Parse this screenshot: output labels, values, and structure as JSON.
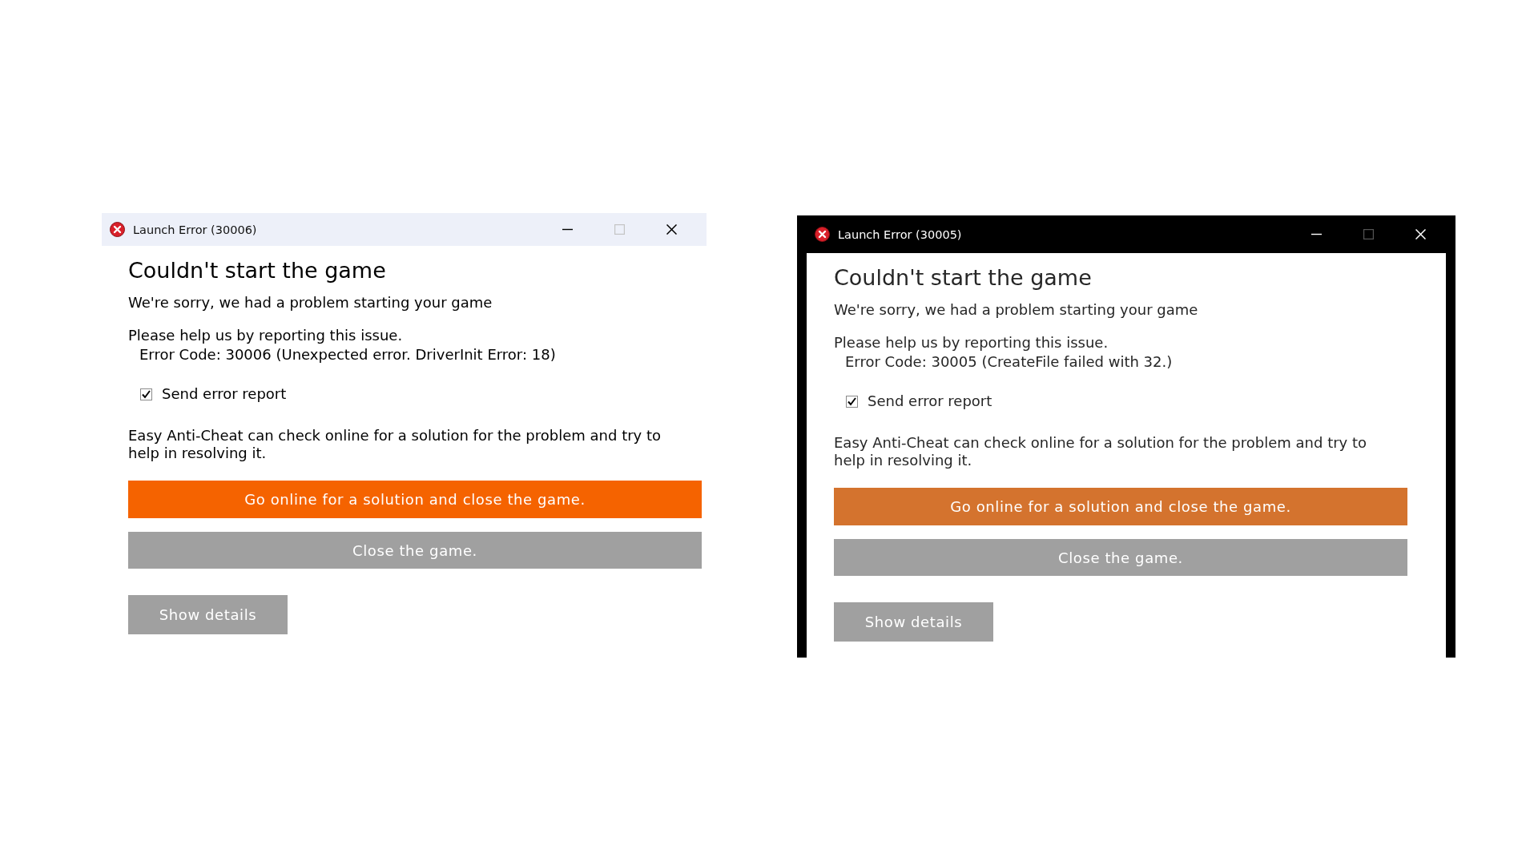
{
  "windows": [
    {
      "kind": "plain",
      "title": "Launch Error (30006)",
      "window_controls": [
        {
          "kind": "minimize",
          "disabled": false
        },
        {
          "kind": "maximize",
          "disabled": true
        },
        {
          "kind": "close",
          "disabled": false
        }
      ],
      "heading": "Couldn't start the game",
      "message": "We're sorry, we had a problem starting your game",
      "report_prompt": "Please help us by reporting this issue.",
      "error_code": "Error Code: 30006 (Unexpected error. DriverInit Error: 18)",
      "send_report": {
        "label": "Send error report",
        "checked": true
      },
      "info": "Easy Anti-Cheat can check online for a solution for the problem and try to help in resolving it.",
      "buttons": [
        {
          "kind": "primary",
          "label": "Go online for a solution and close the game."
        },
        {
          "kind": "secondary",
          "label": "Close the game."
        },
        {
          "kind": "details",
          "label": "Show details"
        }
      ]
    },
    {
      "kind": "framed",
      "title": "Launch Error (30005)",
      "window_controls": [
        {
          "kind": "minimize",
          "disabled": false
        },
        {
          "kind": "maximize",
          "disabled": true
        },
        {
          "kind": "close",
          "disabled": false
        }
      ],
      "heading": "Couldn't start the game",
      "message": "We're sorry, we had a problem starting your game",
      "report_prompt": "Please help us by reporting this issue.",
      "error_code": "Error Code: 30005 (CreateFile failed with 32.)",
      "send_report": {
        "label": "Send error report",
        "checked": true
      },
      "info": "Easy Anti-Cheat can check online for a solution for the problem and try to help in resolving it.",
      "buttons": [
        {
          "kind": "primary",
          "label": "Go online for a solution and close the game."
        },
        {
          "kind": "secondary",
          "label": "Close the game."
        },
        {
          "kind": "details",
          "label": "Show details"
        }
      ]
    }
  ]
}
